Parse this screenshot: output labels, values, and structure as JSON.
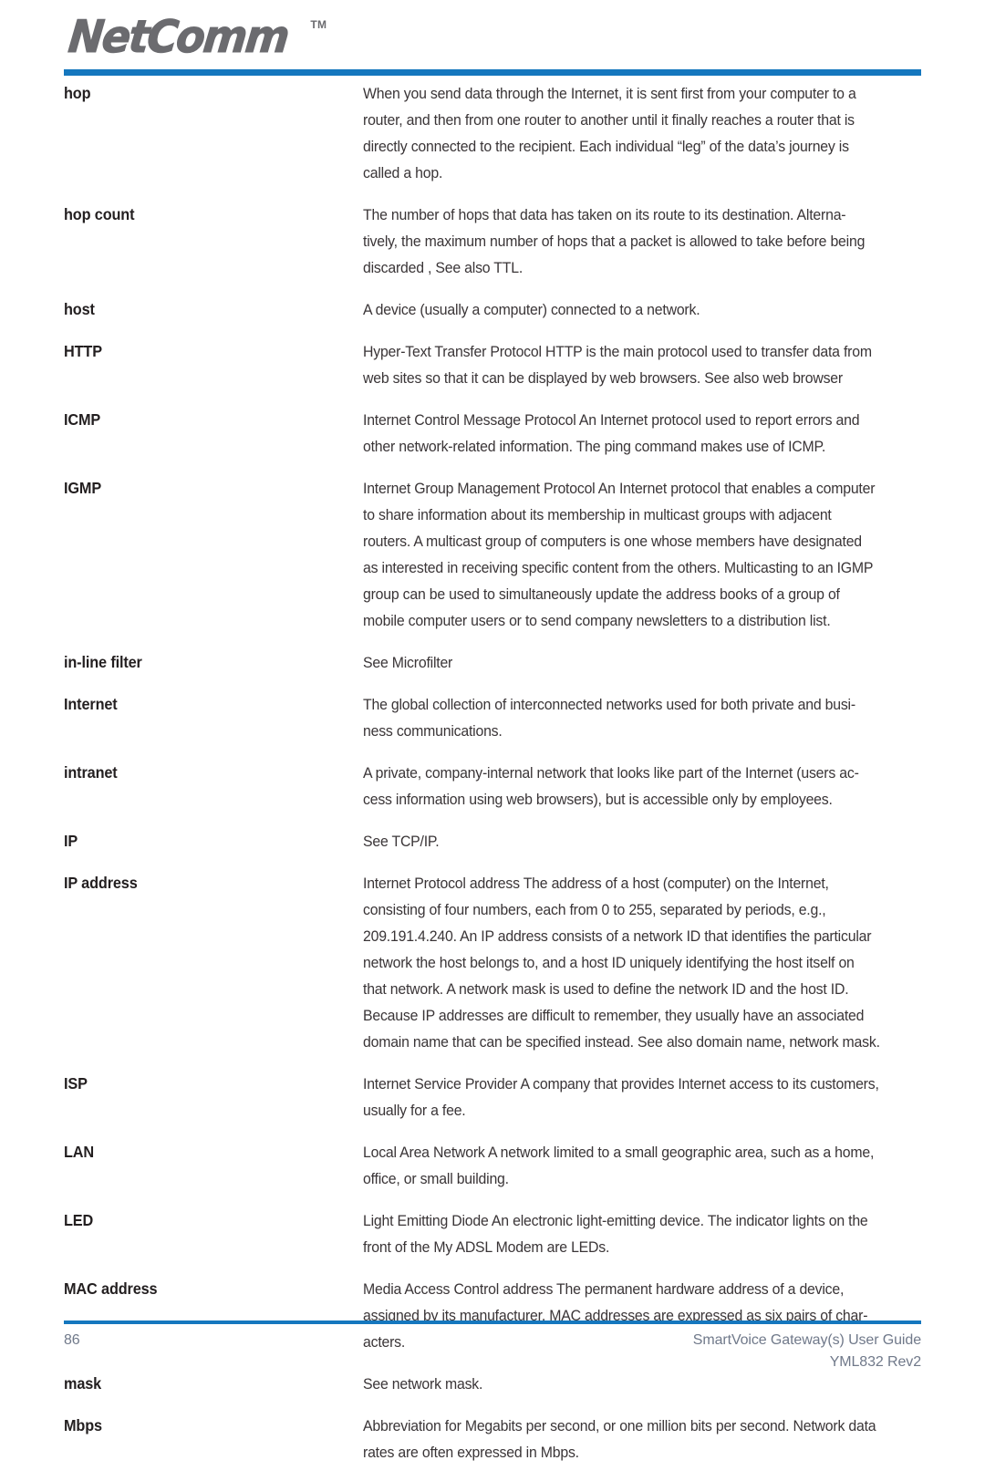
{
  "header": {
    "logo_text": "NetComm",
    "logo_trademark": "TM",
    "rule_color": "#1577be"
  },
  "glossary": {
    "entries": [
      {
        "term": "hop",
        "definition": "When you send data through the Internet, it is sent first from your computer to a\nrouter, and then from one router to another until it finally reaches a router that is\ndirectly connected to the recipient. Each individual “leg” of the data’s journey is\ncalled a hop."
      },
      {
        "term": "hop count",
        "definition": "The number of hops that data has taken on its route to its destination. Alterna-\ntively, the maximum number of hops that a packet is allowed to take before being\ndiscarded , See also TTL."
      },
      {
        "term": "host",
        "definition": "A device (usually a computer) connected to a network."
      },
      {
        "term": "HTTP",
        "definition": "Hyper-Text Transfer Protocol HTTP is the main protocol used to transfer data from\nweb sites so that it can be displayed by web browsers. See also web browser"
      },
      {
        "term": "ICMP",
        "definition": "Internet Control Message Protocol An Internet protocol used to report errors and\nother network-related information. The ping command makes use of ICMP."
      },
      {
        "term": "IGMP",
        "definition": "Internet Group Management Protocol An Internet protocol that enables a computer\nto share information about its membership in multicast groups with adjacent\nrouters. A multicast group of computers is one whose members have designated\nas interested in receiving specific content from the others. Multicasting to an IGMP\ngroup can be used to simultaneously update the address books of a group of\nmobile computer users or to send company newsletters to a distribution list."
      },
      {
        "term": "in-line filter",
        "definition": "See Microfilter"
      },
      {
        "term": "Internet",
        "definition": "The global collection of interconnected networks used for both private and busi-\nness communications."
      },
      {
        "term": "intranet",
        "definition": "A private, company-internal network that looks like part of the Internet (users ac-\ncess information using web browsers), but is accessible only by employees."
      },
      {
        "term": "IP",
        "definition": "See TCP/IP."
      },
      {
        "term": "IP address",
        "definition": "Internet Protocol address The address of a host (computer) on the Internet,\nconsisting of four numbers, each from 0 to 255, separated by periods, e.g.,\n209.191.4.240. An IP address consists of a network ID that identifies the particular\nnetwork the host belongs to, and a host ID uniquely identifying the host itself on\nthat network. A network mask is used to define the network ID and the host ID.\nBecause IP addresses are difficult to remember, they usually have an associated\ndomain name that can be specified instead. See also domain name, network mask."
      },
      {
        "term": "ISP",
        "definition": "Internet Service Provider A company that provides Internet access to its customers,\nusually for a fee."
      },
      {
        "term": "LAN",
        "definition": "Local Area Network A network limited to a small geographic area, such as a home,\noffice, or small building."
      },
      {
        "term": "LED",
        "definition": "Light Emitting Diode An electronic light-emitting device. The indicator lights on the\nfront of the My ADSL Modem are LEDs."
      },
      {
        "term": "MAC address",
        "definition": "Media Access Control address The permanent hardware address of a device,\nassigned by its manufacturer. MAC addresses are expressed as six pairs of char-\nacters."
      },
      {
        "term": "mask",
        "definition": "See network mask."
      },
      {
        "term": "Mbps",
        "definition": "Abbreviation for Megabits per second, or one million bits per second. Network data\nrates are often expressed in Mbps."
      }
    ]
  },
  "footer": {
    "page_number": "86",
    "document_title": "SmartVoice Gateway(s) User Guide",
    "document_code": "YML832 Rev2",
    "text_color": "#70798a"
  }
}
